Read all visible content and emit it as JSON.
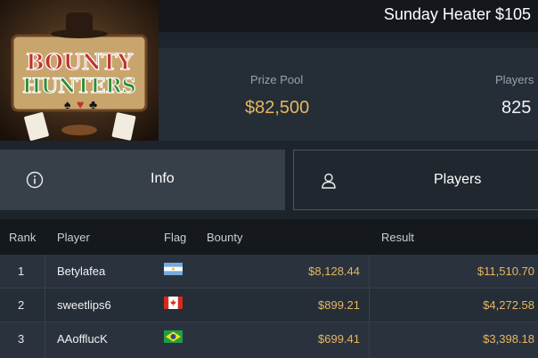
{
  "header": {
    "title": "Sunday Heater $105"
  },
  "logo": {
    "line1": "BOUNTY",
    "line2": "HUNTERS"
  },
  "stats": {
    "prize_pool_label": "Prize Pool",
    "prize_pool_value": "$82,500",
    "players_label": "Players",
    "players_value": "825"
  },
  "tabs": [
    {
      "label": "Info",
      "icon": "info-circle-icon"
    },
    {
      "label": "Players",
      "icon": "user-icon",
      "active": true
    }
  ],
  "table": {
    "headers": {
      "rank": "Rank",
      "player": "Player",
      "flag": "Flag",
      "bounty": "Bounty",
      "result": "Result"
    },
    "rows": [
      {
        "rank": "1",
        "player": "Betylafea",
        "flag": "argentina",
        "bounty": "$8,128.44",
        "result": "$11,510.70"
      },
      {
        "rank": "2",
        "player": "sweetlips6",
        "flag": "canada",
        "bounty": "$899.21",
        "result": "$4,272.58"
      },
      {
        "rank": "3",
        "player": "AAofflucK",
        "flag": "brazil",
        "bounty": "$699.41",
        "result": "$3,398.18"
      }
    ]
  },
  "colors": {
    "accent_gold": "#e7b660",
    "background": "#1e242b",
    "logo_red": "#c0322d",
    "logo_green": "#2f8a34"
  }
}
